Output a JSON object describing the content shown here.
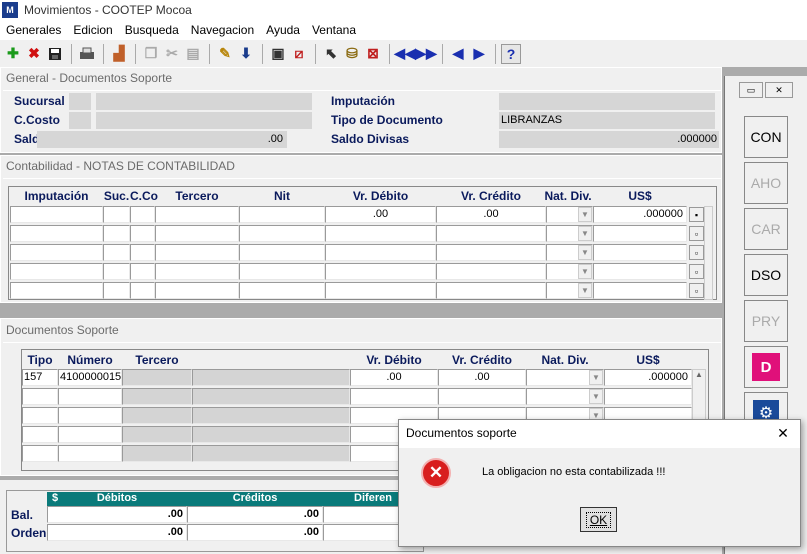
{
  "window": {
    "title": "Movimientos - COOTEP Mocoa",
    "app_icon": "app-icon"
  },
  "menu": [
    "Generales",
    "Edicion",
    "Busqueda",
    "Navegacion",
    "Ayuda",
    "Ventana"
  ],
  "general": {
    "title": "General - Documentos Soporte",
    "sucursal_label": "Sucursal",
    "ccosto_label": "C.Costo",
    "saldo_label": "Saldo",
    "saldo_value": ".00",
    "imputacion_label": "Imputación",
    "tipo_doc_label": "Tipo de Documento",
    "tipo_doc_value": "LIBRANZAS",
    "saldo_divisas_label": "Saldo Divisas",
    "saldo_divisas_value": ".000000"
  },
  "contabilidad": {
    "title": "Contabilidad   -   NOTAS DE CONTABILIDAD",
    "columns": [
      "Imputación",
      "Suc.",
      "C.Co",
      "Tercero",
      "Nit",
      "Vr. Débito",
      "Vr. Crédito",
      "Nat. Div.",
      "US$"
    ],
    "row1": {
      "debito": ".00",
      "credito": ".00",
      "usd": ".000000"
    }
  },
  "documentos": {
    "title": "Documentos Soporte",
    "columns": [
      "Tipo",
      "Número",
      "Tercero",
      "Vr. Débito",
      "Vr. Crédito",
      "Nat. Div.",
      "US$"
    ],
    "row1": {
      "tipo": "157",
      "numero": "4100000015",
      "debito": ".00",
      "credito": ".00",
      "usd": ".000000"
    }
  },
  "balance": {
    "columns": [
      "$",
      "Débitos",
      "Créditos",
      "Diferen"
    ],
    "bal_label": "Bal.",
    "orden_label": "Orden",
    "bal_debitos": ".00",
    "bal_creditos": ".00",
    "orden_debitos": ".00",
    "orden_creditos": ".00"
  },
  "side_buttons": [
    "CON",
    "AHO",
    "CAR",
    "DSO",
    "PRY"
  ],
  "dialog": {
    "title": "Documentos soporte",
    "message": "La obligacion no esta contabilizada !!!",
    "ok_label": "OK",
    "close_glyph": "✕",
    "error_glyph": "✕"
  }
}
